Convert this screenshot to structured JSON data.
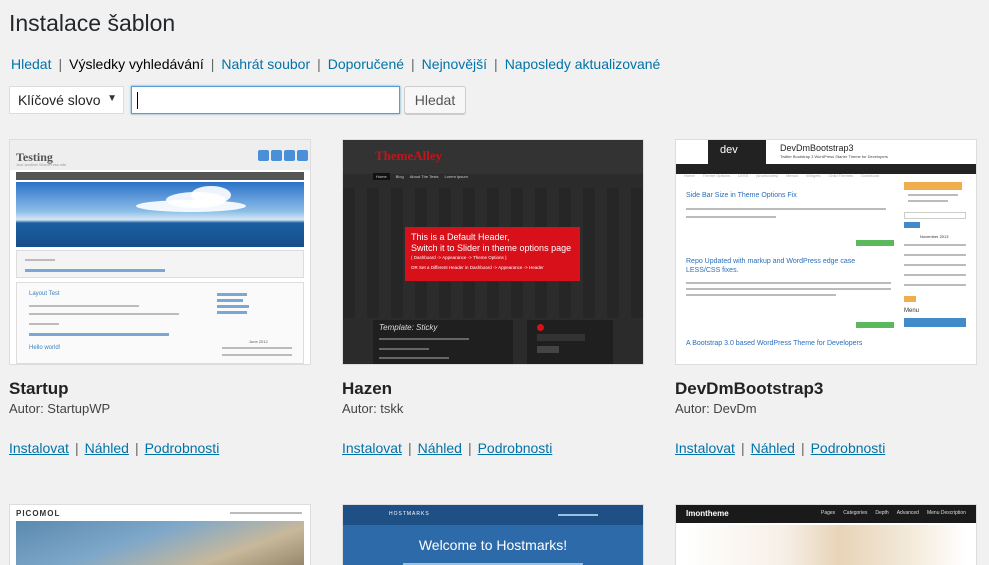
{
  "page": {
    "title": "Instalace šablon"
  },
  "subnav": {
    "items": [
      {
        "label": "Hledat",
        "current": false
      },
      {
        "label": "Výsledky vyhledávání",
        "current": true
      },
      {
        "label": "Nahrát soubor",
        "current": false
      },
      {
        "label": "Doporučené",
        "current": false
      },
      {
        "label": "Nejnovější",
        "current": false
      },
      {
        "label": "Naposledy aktualizované",
        "current": false
      }
    ],
    "separator": "|"
  },
  "search": {
    "type_selected": "Klíčové slovo",
    "query": "",
    "button_label": "Hledat"
  },
  "actions": {
    "install": "Instalovat",
    "preview": "Náhled",
    "details": "Podrobnosti"
  },
  "themes": [
    {
      "name": "Startup",
      "author": "Autor: StartupWP"
    },
    {
      "name": "Hazen",
      "author": "Autor: tskk"
    },
    {
      "name": "DevDmBootstrap3",
      "author": "Autor: DevDm"
    }
  ],
  "thumbs": {
    "startup": {
      "site_title": "Testing",
      "tagline": "Just another WordPress site",
      "nav": [
        "Level 1 ▾",
        "Lorem Ipsum",
        "Level 1",
        "Level 2",
        "Level 3"
      ],
      "post_title": "Layout Test",
      "post2_title": "Hello world!",
      "calendar_title": "June 2012"
    },
    "hazen": {
      "logo": "ThemeAlley",
      "nav": [
        "Home",
        "Blog",
        "About The Tests",
        "Lorem Ipsum"
      ],
      "header_line1": "This is a Default Header,",
      "header_line2": "Switch it to Slider in theme options page",
      "header_line3": "( Dashboard -> Appearance -> Theme Options )",
      "header_line4": "OR Set a Different Header in Dashboard -> Appearance -> Header",
      "post_title": "Template: Sticky"
    },
    "devdm": {
      "logo": "dev",
      "title": "DevDmBootstrap3",
      "subtitle": "Twitter Bootstrap 3 WordPress Starter Theme for Developers",
      "nav": [
        "Home",
        "Theme Options",
        "LESS",
        "[shortcodes]",
        "Menus",
        "Widgets",
        "Child Themes",
        "Download"
      ],
      "post1": "Side Bar Size in Theme Options Fix",
      "post2": "Repo Updated with markup and WordPress edge case LESS/CSS fixes.",
      "post3": "A Bootstrap 3.0 based WordPress Theme for Developers",
      "calendar_title": "November 2013",
      "menu_title": "Menu"
    },
    "picomol": {
      "logo": "PICOMOL"
    },
    "hostmarks": {
      "logo": "HOSTMARKS",
      "welcome": "Welcome to Hostmarks!"
    },
    "imontheme": {
      "logo": "Imontheme",
      "nav": [
        "Pages",
        "Categories",
        "Depth",
        "Advanced",
        "Menu Description"
      ]
    }
  },
  "colors": {
    "link": "#0073aa",
    "background": "#f1f1f1",
    "hazen_red": "#d8101a"
  }
}
